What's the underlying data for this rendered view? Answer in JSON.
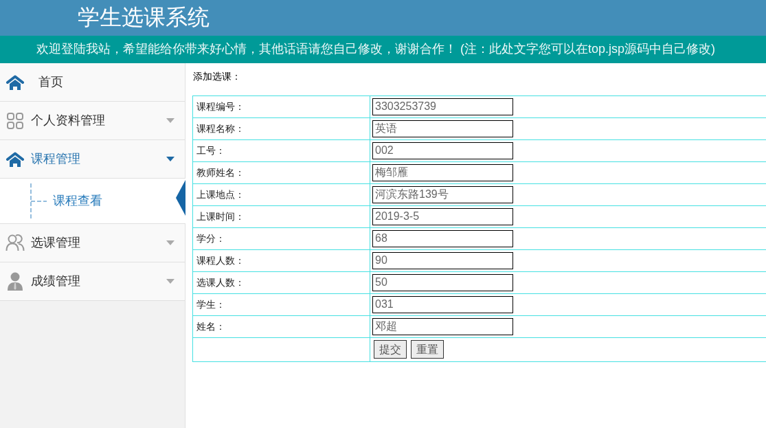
{
  "header": {
    "title": "学生选课系统"
  },
  "notice": "欢迎登陆我站，希望能给你带来好心情，其他话语请您自己修改，谢谢合作！ (注：此处文字您可以在top.jsp源码中自己修改)",
  "sidebar": {
    "items": [
      {
        "kind": "link",
        "label": "首页",
        "expanded": false
      },
      {
        "kind": "menu",
        "label": "个人资料管理",
        "expanded": false
      },
      {
        "kind": "menu",
        "label": "课程管理",
        "expanded": true,
        "children": [
          {
            "label": "课程查看",
            "selected": true
          }
        ]
      },
      {
        "kind": "menu",
        "label": "选课管理",
        "expanded": false
      },
      {
        "kind": "menu",
        "label": "成绩管理",
        "expanded": false
      }
    ]
  },
  "form": {
    "title": "添加选课：",
    "fields": [
      {
        "label": "课程编号：",
        "value": "3303253739"
      },
      {
        "label": "课程名称：",
        "value": "英语"
      },
      {
        "label": "工号：",
        "value": "002"
      },
      {
        "label": "教师姓名：",
        "value": "梅邹雁"
      },
      {
        "label": "上课地点：",
        "value": "河滨东路139号"
      },
      {
        "label": "上课时间：",
        "value": "2019-3-5"
      },
      {
        "label": "学分：",
        "value": "68"
      },
      {
        "label": "课程人数：",
        "value": "90"
      },
      {
        "label": "选课人数：",
        "value": "50"
      },
      {
        "label": "学生：",
        "value": "031"
      },
      {
        "label": "姓名：",
        "value": "邓超"
      }
    ],
    "buttons": [
      "提交",
      "重置"
    ]
  }
}
